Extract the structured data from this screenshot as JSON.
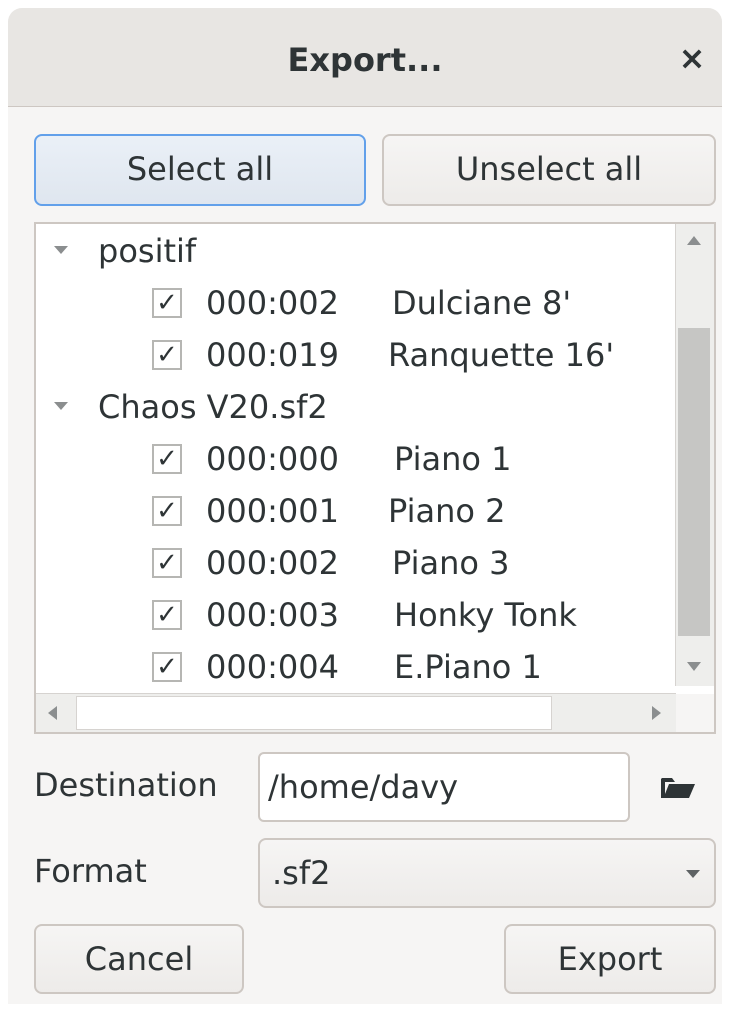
{
  "window": {
    "title": "Export...",
    "close_glyph": "×"
  },
  "buttons": {
    "select_all": "Select all",
    "unselect_all": "Unselect all",
    "cancel": "Cancel",
    "export": "Export"
  },
  "tree": {
    "groups": [
      {
        "label": "positif",
        "items": [
          {
            "checked": true,
            "check_glyph": "✓",
            "code": "000:002",
            "name": "Dulciane 8'"
          },
          {
            "checked": true,
            "check_glyph": "✓",
            "code": "000:019",
            "name": "Ranquette 16'"
          }
        ]
      },
      {
        "label": "Chaos V20.sf2",
        "items": [
          {
            "checked": true,
            "check_glyph": "✓",
            "code": "000:000",
            "name": "Piano 1"
          },
          {
            "checked": true,
            "check_glyph": "✓",
            "code": "000:001",
            "name": "Piano 2"
          },
          {
            "checked": true,
            "check_glyph": "✓",
            "code": "000:002",
            "name": "Piano 3"
          },
          {
            "checked": true,
            "check_glyph": "✓",
            "code": "000:003",
            "name": "Honky Tonk"
          },
          {
            "checked": true,
            "check_glyph": "✓",
            "code": "000:004",
            "name": "E.Piano 1"
          }
        ]
      }
    ]
  },
  "destination": {
    "label": "Destination",
    "value": "/home/davy",
    "browse_icon": "folder-open-icon"
  },
  "format": {
    "label": "Format",
    "value": ".sf2"
  },
  "colors": {
    "accent": "#62a0ea",
    "titlebar": "#e8e6e3",
    "window_bg": "#f6f5f4"
  }
}
